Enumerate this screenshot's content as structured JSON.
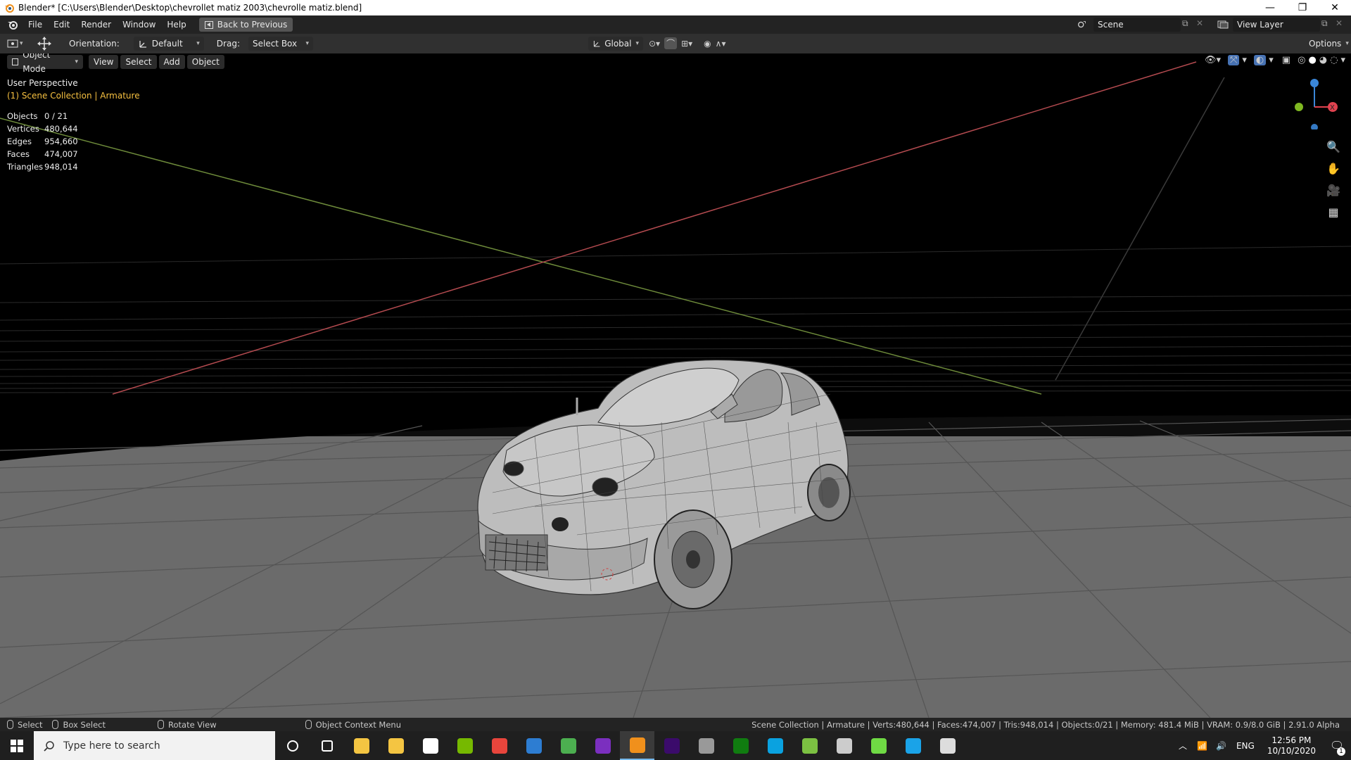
{
  "window": {
    "title": "Blender* [C:\\Users\\Blender\\Desktop\\chevrollet matiz 2003\\chevrolle matiz.blend]",
    "controls": [
      "—",
      "❐",
      "✕"
    ]
  },
  "menubar": {
    "items": [
      "File",
      "Edit",
      "Render",
      "Window",
      "Help"
    ],
    "back_button": "Back to Previous",
    "scene_label": "Scene",
    "view_layer_label": "View Layer"
  },
  "toolheader": {
    "orientation_label": "Orientation:",
    "orientation_value": "Default",
    "drag_label": "Drag:",
    "drag_value": "Select Box",
    "transform_orientation": "Global",
    "options_label": "Options"
  },
  "viewport_header": {
    "mode": "Object Mode",
    "menus": [
      "View",
      "Select",
      "Add",
      "Object"
    ]
  },
  "viewport": {
    "view_name": "User Perspective",
    "collection": "(1) Scene Collection | Armature",
    "stats": [
      {
        "key": "Objects",
        "value": "0 / 21"
      },
      {
        "key": "Vertices",
        "value": "480,644"
      },
      {
        "key": "Edges",
        "value": "954,660"
      },
      {
        "key": "Faces",
        "value": "474,007"
      },
      {
        "key": "Triangles",
        "value": "948,014"
      }
    ],
    "gizmo_axes": {
      "x": "X",
      "x_color": "#e0424f",
      "y_color": "#7fb821",
      "z_color": "#3a86d8"
    }
  },
  "statusbar": {
    "select": "Select",
    "box_select": "Box Select",
    "rotate_view": "Rotate View",
    "context_menu": "Object Context Menu",
    "info": "Scene Collection | Armature | Verts:480,644 | Faces:474,007 | Tris:948,014 | Objects:0/21 | Memory: 481.4 MiB | VRAM: 0.9/8.0 GiB | 2.91.0 Alpha"
  },
  "taskbar": {
    "search_placeholder": "Type here to search",
    "language": "ENG",
    "time": "12:56 PM",
    "date": "10/10/2020",
    "notification_count": "1",
    "apps": [
      {
        "name": "cortana-icon",
        "color": "#ffffff"
      },
      {
        "name": "task-view-icon",
        "color": "#ffffff"
      },
      {
        "name": "file-explorer-icon",
        "color": "#f4c542"
      },
      {
        "name": "store-icon",
        "color": "#f4c542"
      },
      {
        "name": "mail-icon",
        "color": "#ffffff"
      },
      {
        "name": "nvidia-icon",
        "color": "#76b900"
      },
      {
        "name": "chrome-icon",
        "color": "#e8453c"
      },
      {
        "name": "calculator-app-icon",
        "color": "#2d7dd2"
      },
      {
        "name": "photos-icon",
        "color": "#4caf50"
      },
      {
        "name": "purple-app-icon",
        "color": "#7b2fbf"
      },
      {
        "name": "blender-icon",
        "color": "#f0901c"
      },
      {
        "name": "premiere-icon",
        "color": "#3b0b6b"
      },
      {
        "name": "game-icon",
        "color": "#999999"
      },
      {
        "name": "xbox-icon",
        "color": "#107c10"
      },
      {
        "name": "skype-icon",
        "color": "#0aa2e0"
      },
      {
        "name": "green-app-icon",
        "color": "#7cc142"
      },
      {
        "name": "calculator-icon",
        "color": "#cccccc"
      },
      {
        "name": "upwork-icon",
        "color": "#6fda44"
      },
      {
        "name": "edge-icon",
        "color": "#1aa3e8"
      },
      {
        "name": "epic-games-icon",
        "color": "#dddddd"
      }
    ]
  }
}
